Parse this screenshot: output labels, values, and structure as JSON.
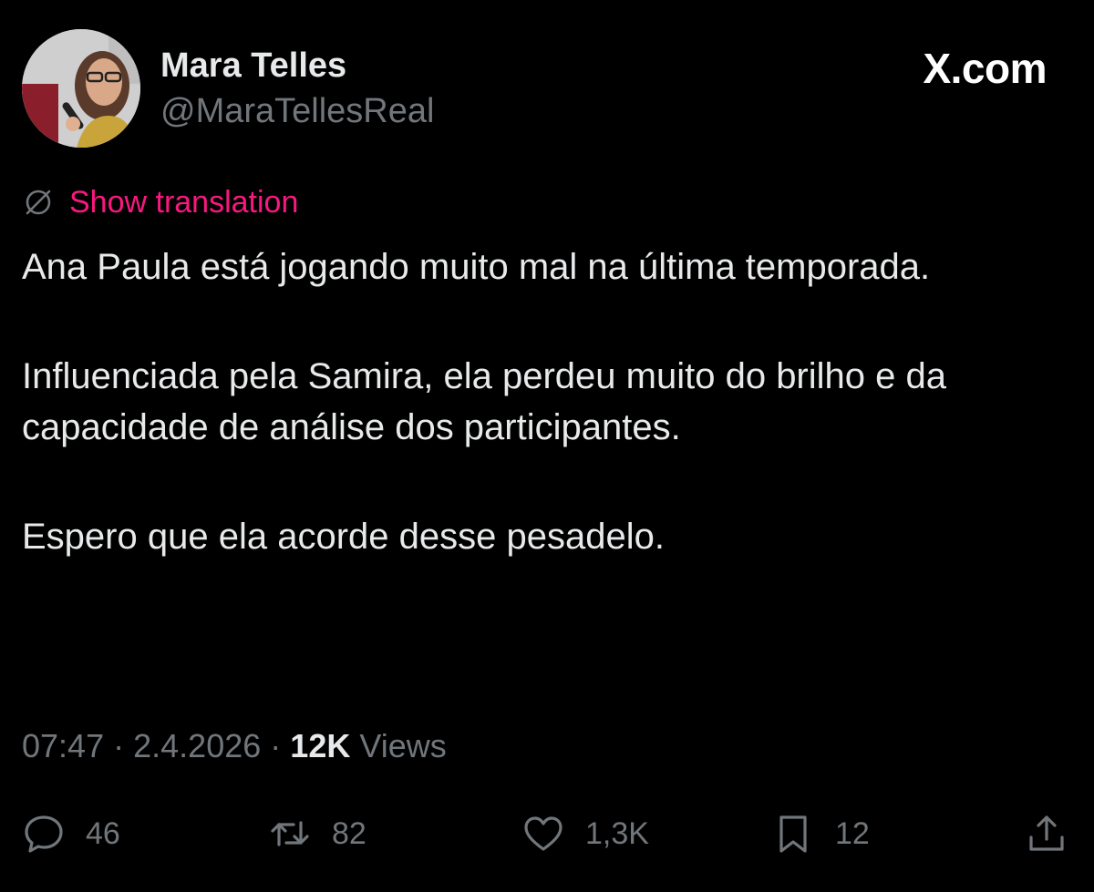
{
  "author": {
    "display_name": "Mara Telles",
    "handle": "@MaraTellesReal",
    "avatar_icon": "user-avatar-photo"
  },
  "brand": {
    "label": "X.com"
  },
  "translation": {
    "icon": "globe-icon",
    "label": "Show translation"
  },
  "tweet": {
    "paragraphs": [
      "Ana Paula está jogando muito mal na última temporada.",
      "Influenciada pela Samira, ela perdeu muito do brilho e da capacidade de análise dos participantes.",
      "Espero que ela acorde desse pesadelo."
    ]
  },
  "meta": {
    "time": "07:47",
    "separator": "·",
    "date": "2.4.2026",
    "views_count": "12K",
    "views_label": "Views"
  },
  "actions": {
    "replies": "46",
    "reposts": "82",
    "likes": "1,3K",
    "bookmarks": "12"
  },
  "colors": {
    "background": "#000000",
    "text": "#e7e9ea",
    "secondary": "#71767b",
    "accent": "#f91880"
  }
}
